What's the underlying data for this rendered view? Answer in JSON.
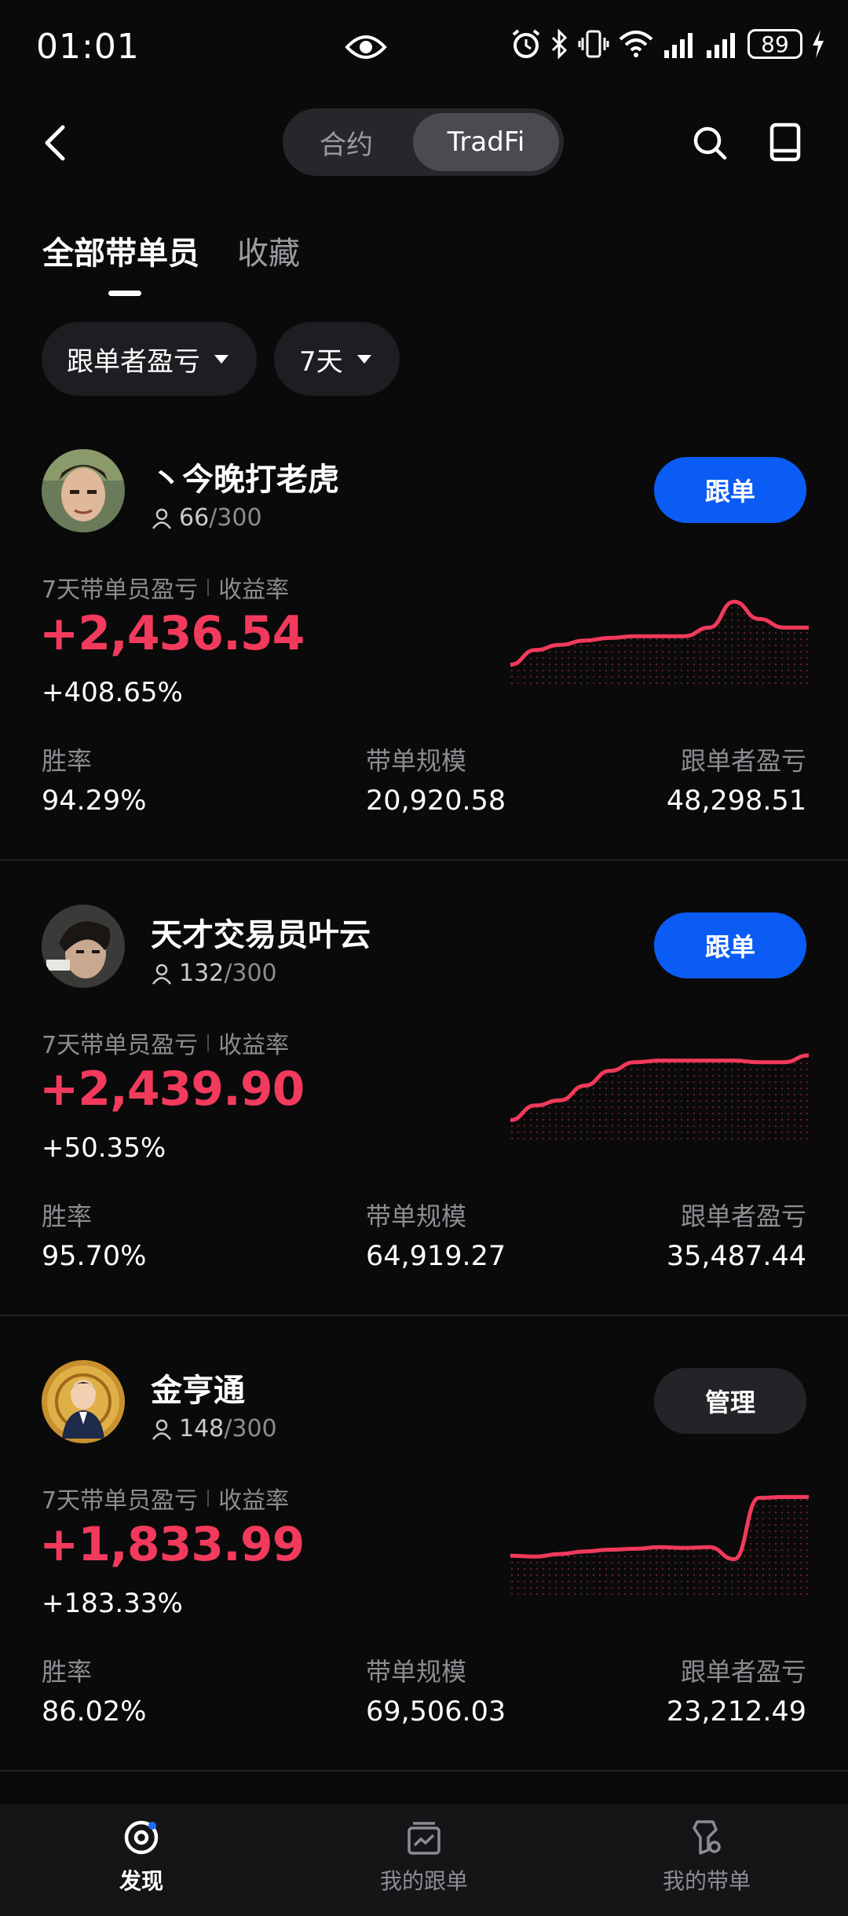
{
  "status_bar": {
    "time": "01:01",
    "battery": "89"
  },
  "header": {
    "segments": [
      {
        "label": "合约",
        "active": false
      },
      {
        "label": "TradFi",
        "active": true
      }
    ]
  },
  "tabs": [
    {
      "label": "全部带单员",
      "active": true
    },
    {
      "label": "收藏",
      "active": false
    }
  ],
  "filters": [
    {
      "label": "跟单者盈亏"
    },
    {
      "label": "7天"
    }
  ],
  "card_labels": {
    "pnl_label": "7天带单员盈亏",
    "roi_label": "收益率",
    "win_rate": "胜率",
    "scale": "带单规模",
    "follower_pnl": "跟单者盈亏"
  },
  "traders": [
    {
      "name": "丶今晚打老虎",
      "followers": "66",
      "followers_max": "/300",
      "action": "跟单",
      "pnl": "+2,436.54",
      "roi": "+408.65%",
      "win_rate": "94.29%",
      "scale": "20,920.58",
      "follower_pnl": "48,298.51",
      "trend": [
        0.05,
        0.22,
        0.28,
        0.33,
        0.36,
        0.38,
        0.38,
        0.38,
        0.48,
        0.78,
        0.58,
        0.48,
        0.48
      ]
    },
    {
      "name": "天才交易员叶云",
      "followers": "132",
      "followers_max": "/300",
      "action": "跟单",
      "pnl": "+2,439.90",
      "roi": "+50.35%",
      "win_rate": "95.70%",
      "scale": "64,919.27",
      "follower_pnl": "35,487.44",
      "trend": [
        0.05,
        0.22,
        0.28,
        0.45,
        0.62,
        0.72,
        0.74,
        0.74,
        0.74,
        0.74,
        0.72,
        0.72,
        0.8
      ]
    },
    {
      "name": "金亨通",
      "followers": "148",
      "followers_max": "/300",
      "action": "管理",
      "pnl": "+1,833.99",
      "roi": "+183.33%",
      "win_rate": "86.02%",
      "scale": "69,506.03",
      "follower_pnl": "23,212.49",
      "trend": [
        0.28,
        0.27,
        0.3,
        0.33,
        0.35,
        0.36,
        0.38,
        0.37,
        0.38,
        0.24,
        0.95,
        0.96,
        0.96
      ]
    }
  ],
  "bottom_nav": [
    {
      "label": "发现",
      "active": true
    },
    {
      "label": "我的跟单",
      "active": false
    },
    {
      "label": "我的带单",
      "active": false
    }
  ],
  "colors": {
    "background": "#0a0a0a",
    "profit": "#f23a5c",
    "primary_button": "#0a5cf5",
    "secondary_button": "#232428",
    "text_muted": "#8b8d92"
  }
}
